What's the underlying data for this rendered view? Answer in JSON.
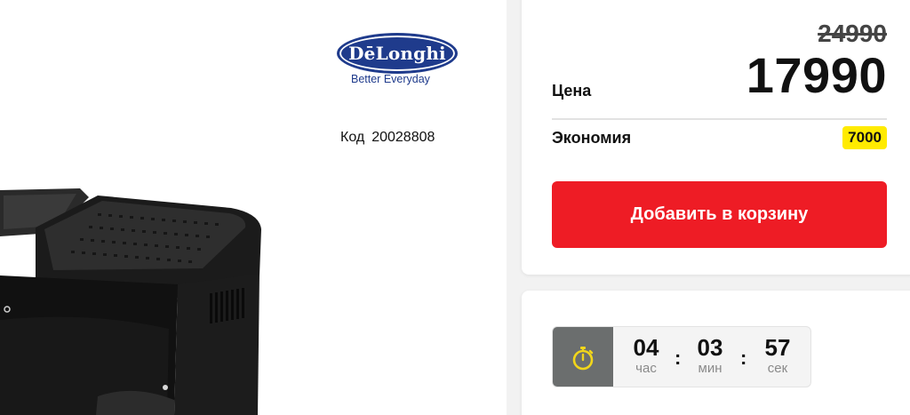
{
  "brand": {
    "name": "DēLonghi",
    "tagline": "Better Everyday"
  },
  "product": {
    "code_label": "Код",
    "code_value": "20028808"
  },
  "price": {
    "old": "24990",
    "label": "Цена",
    "current": "17990",
    "saving_label": "Экономия",
    "saving_value": "7000",
    "add_to_cart": "Добавить в корзину"
  },
  "timer": {
    "hours": "04",
    "hours_unit": "час",
    "minutes": "03",
    "minutes_unit": "мин",
    "seconds": "57",
    "seconds_unit": "сек"
  },
  "colors": {
    "brand_blue": "#1f3b8c",
    "cart_red": "#ee1c25",
    "saving_yellow": "#ffeb00",
    "timer_icon_bg": "#6b6e6e",
    "timer_icon_yellow": "#f2d61a"
  }
}
